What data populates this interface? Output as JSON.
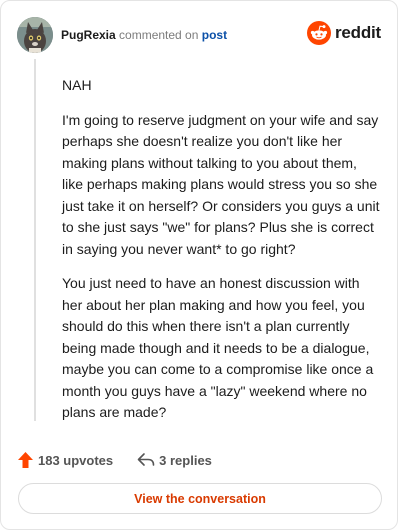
{
  "header": {
    "username": "PugRexia",
    "commented_on": "commented on",
    "post_link": "post",
    "logo_text": "reddit"
  },
  "comment": {
    "paragraphs": [
      "NAH",
      "I'm going to reserve judgment on your wife and say perhaps she doesn't realize you don't like her making plans without talking to you about them, like perhaps making plans would stress you so she just take it on herself? Or considers you guys a unit to she just says \"we\" for plans? Plus she is correct in saying you never want* to go right?",
      "You just need to have an honest discussion with her about her plan making and how you feel, you should do this when there isn't a plan currently being made though and it needs to be a dialogue, maybe you can come to a compromise like once a month you guys have a \"lazy\" weekend where no plans are made?"
    ]
  },
  "actions": {
    "upvotes": "183 upvotes",
    "replies": "3 replies"
  },
  "footer": {
    "view_conversation": "View the conversation"
  },
  "colors": {
    "brand": "#ff4500",
    "upvote": "#ff4500",
    "link": "#0b50a8",
    "cta": "#d93a00"
  },
  "icons": {
    "avatar": "cat-avatar",
    "logo": "reddit-snoo-icon",
    "upvote": "upvote-arrow-icon",
    "reply": "reply-arrow-icon"
  }
}
